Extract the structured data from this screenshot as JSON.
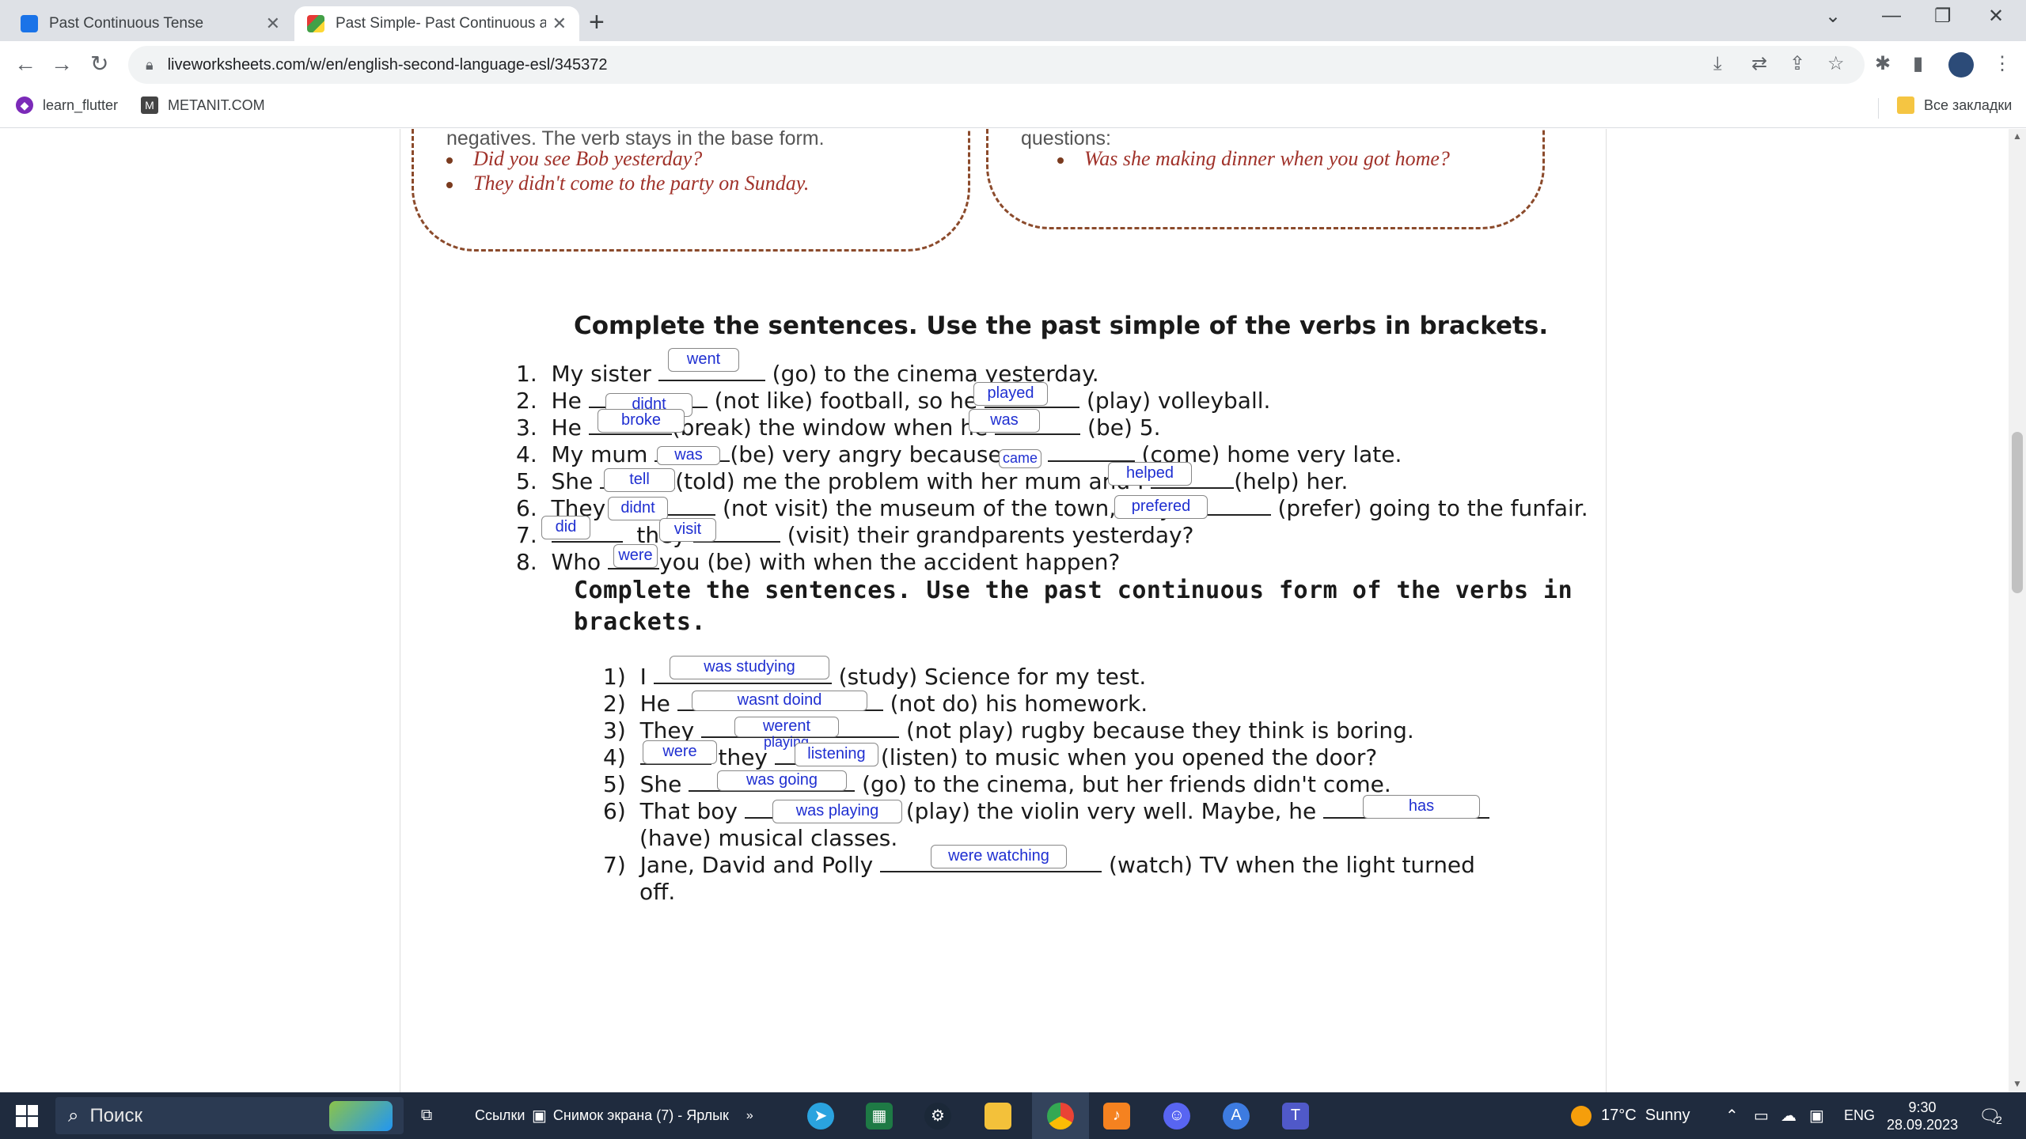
{
  "tabs": [
    {
      "title": "Past Continuous Tense",
      "active": false
    },
    {
      "title": "Past Simple- Past Continuous ac",
      "active": true
    }
  ],
  "address_bar": {
    "url": "liveworksheets.com/w/en/english-second-language-esl/345372"
  },
  "bookmarks": {
    "items": [
      {
        "label": "learn_flutter"
      },
      {
        "label": "METANIT.COM"
      }
    ],
    "all_bookmarks": "Все закладки"
  },
  "worksheet": {
    "top_left": {
      "text": "negatives. The verb stays in the base form.",
      "examples": [
        "Did you see Bob yesterday?",
        "They didn't come to the party on Sunday."
      ]
    },
    "top_right": {
      "text": "questions:",
      "examples": [
        "Was she making dinner when you got home?"
      ]
    },
    "section1": {
      "title": "Complete the sentences. Use the past simple of the verbs in brackets.",
      "lines": [
        {
          "num": "1.",
          "a": "My sister",
          "b": "(go) to the cinema yesterday."
        },
        {
          "num": "2.",
          "a": "He",
          "b": "(not like) football, so he",
          "c": "(play) volleyball."
        },
        {
          "num": "3.",
          "a": "He",
          "b": "(break) the window when he",
          "c": "(be) 5."
        },
        {
          "num": "4.",
          "a": "My mum",
          "b": "(be) very angry because we",
          "c": "(come) home very late."
        },
        {
          "num": "5.",
          "a": "She",
          "b": "(told) me the problem with her mum and I",
          "c": "(help) her."
        },
        {
          "num": "6.",
          "a": "They",
          "b": "(not visit) the museum of the town, they",
          "c": "(prefer) going to the funfair."
        },
        {
          "num": "7.",
          "a": "",
          "b": "they",
          "c": "(visit) their grandparents yesterday?"
        },
        {
          "num": "8.",
          "a": "Who",
          "b": "you (be) with when the accident happen?"
        }
      ],
      "answers": [
        "went",
        "didnt",
        "played",
        "broke",
        "was",
        "was",
        "came",
        "tell",
        "helped",
        "didnt",
        "prefered",
        "did",
        "visit",
        "were"
      ]
    },
    "section2": {
      "title_line1": "Complete the sentences. Use the past continuous form of the verbs in",
      "title_line2": "brackets.",
      "lines": [
        {
          "num": "1)",
          "a": "I",
          "b": "(study) Science for my test."
        },
        {
          "num": "2)",
          "a": "He",
          "b": "(not do) his homework."
        },
        {
          "num": "3)",
          "a": "They",
          "b": "(not play) rugby because they think is boring."
        },
        {
          "num": "4)",
          "a": "",
          "b": "they",
          "c": "(listen) to music when you opened the door?"
        },
        {
          "num": "5)",
          "a": "She",
          "b": "(go) to the cinema, but her friends didn't come."
        },
        {
          "num": "6)",
          "a": "That boy",
          "b": "(play) the violin very well. Maybe, he",
          "c": "(have) musical classes."
        },
        {
          "num": "7)",
          "a": "Jane, David and Polly",
          "b": "(watch) TV when the light turned",
          "c": "off."
        }
      ],
      "answers": [
        "was studying",
        "wasnt doind",
        "werent",
        "playing",
        "were",
        "listening",
        "was going",
        "was playing",
        "has",
        "were watching"
      ]
    }
  },
  "taskbar": {
    "search_placeholder": "Поиск",
    "links_label": "Ссылки",
    "shortcut_label": "Снимок экрана (7) - Ярлык",
    "weather": "17°C  Sunny",
    "lang": "ENG",
    "time": "9:30",
    "date": "28.09.2023",
    "notifications": "2"
  },
  "colors": {
    "answer_text": "#1f2fd1",
    "example_text": "#a0322a",
    "bubble_border": "#8b4a2b",
    "taskbar_bg": "#1f2b3e"
  }
}
